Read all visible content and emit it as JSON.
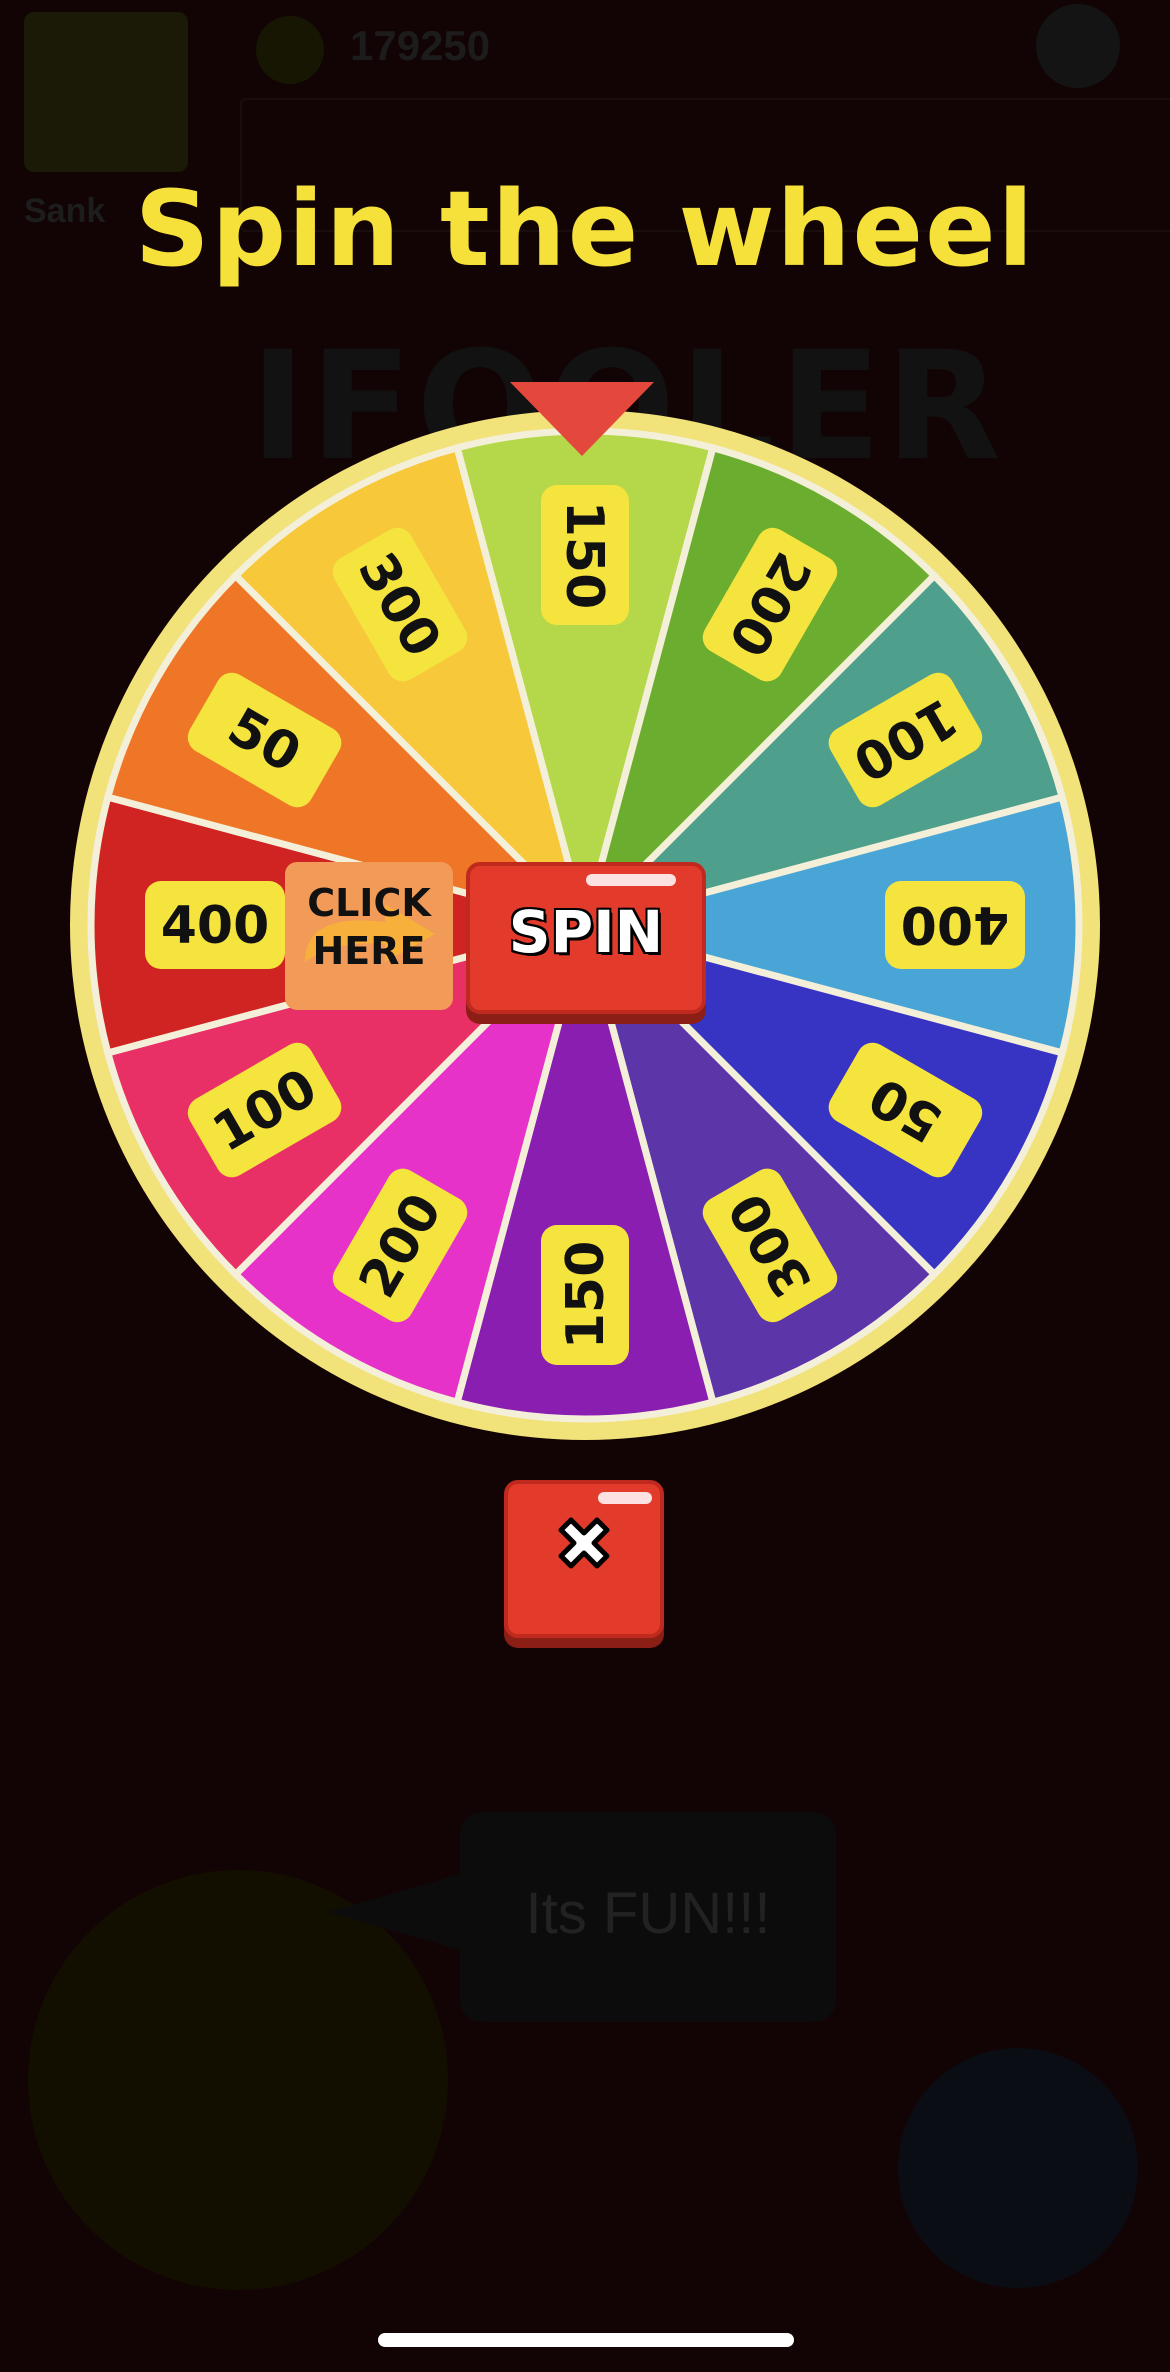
{
  "background": {
    "player_name": "Sank",
    "coins": "179250",
    "logo_text": "IFOOLER",
    "bubble_text": "Its FUN!!!"
  },
  "popup": {
    "title": "Spin the wheel",
    "spin_label": "SPIN",
    "click_here_line1": "CLICK",
    "click_here_line2": "HERE",
    "close_icon": "close-x-icon",
    "pointer_color": "#e4483d",
    "button_color": "#e23b2c",
    "title_color": "#f5e13a"
  },
  "wheel": {
    "rim_color": "#f1e27a",
    "segments": [
      {
        "value": "150",
        "color": "#b5d84a"
      },
      {
        "value": "200",
        "color": "#6aad2f"
      },
      {
        "value": "100",
        "color": "#4f9f8d"
      },
      {
        "value": "400",
        "color": "#4aa5d7"
      },
      {
        "value": "50",
        "color": "#3734c4"
      },
      {
        "value": "300",
        "color": "#5c35a9"
      },
      {
        "value": "150",
        "color": "#8a1eb0"
      },
      {
        "value": "200",
        "color": "#e632c8"
      },
      {
        "value": "100",
        "color": "#e83066"
      },
      {
        "value": "400",
        "color": "#cf2422"
      },
      {
        "value": "50",
        "color": "#ee7626"
      },
      {
        "value": "300",
        "color": "#f7c83a"
      }
    ]
  }
}
